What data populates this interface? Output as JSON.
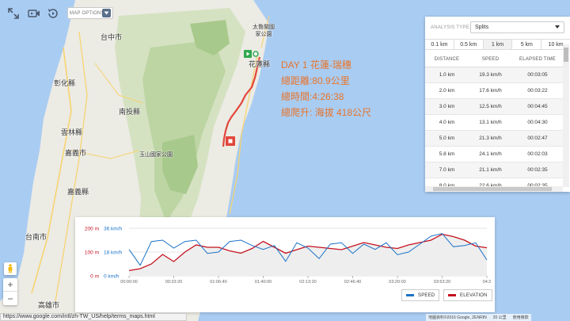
{
  "map": {
    "options_label": "MAP OPTIONS",
    "cities": [
      {
        "name": "台中市"
      },
      {
        "name": "彰化縣"
      },
      {
        "name": "南投縣"
      },
      {
        "name": "雲林縣"
      },
      {
        "name": "嘉義市"
      },
      {
        "name": "嘉義縣"
      },
      {
        "name": "台南市"
      },
      {
        "name": "高雄市"
      },
      {
        "name": "花蓮縣"
      },
      {
        "name": "太魯閣國家公園"
      },
      {
        "name": "玉山國家公園"
      }
    ],
    "route_color": "#e2463c",
    "start_marker_color": "#2fa84f",
    "end_marker_color": "#e2463c",
    "zoom_in": "+",
    "zoom_out": "−"
  },
  "day": {
    "title": "DAY 1 花蓮-瑞穗",
    "distance": "總距離:80.9公里",
    "time": "總時間:4:26:38",
    "climb": "總爬升: 海拔 418公尺",
    "color": "#e8742a"
  },
  "analysis": {
    "type_label": "ANALYSIS TYPE:",
    "type_value": "Splits",
    "tabs": [
      {
        "label": "0.1 km",
        "active": false
      },
      {
        "label": "0.5 km",
        "active": false
      },
      {
        "label": "1 km",
        "active": true
      },
      {
        "label": "5 km",
        "active": false
      },
      {
        "label": "10 km",
        "active": false
      }
    ],
    "columns": [
      "DISTANCE",
      "SPEED",
      "ELAPSED TIME"
    ],
    "rows": [
      [
        "1.0 km",
        "19.3 km/h",
        "00:03:05"
      ],
      [
        "2.0 km",
        "17.6 km/h",
        "00:03:22"
      ],
      [
        "3.0 km",
        "12.5 km/h",
        "00:04:45"
      ],
      [
        "4.0 km",
        "13.1 km/h",
        "00:04:30"
      ],
      [
        "5.0 km",
        "21.3 km/h",
        "00:02:47"
      ],
      [
        "5.8 km",
        "24.1 km/h",
        "00:02:03"
      ],
      [
        "7.0 km",
        "21.1 km/h",
        "00:02:35"
      ],
      [
        "8.0 km",
        "22.6 km/h",
        "00:02:35"
      ],
      [
        "9.0 km",
        "22.3 km/h",
        "00:02:40"
      ]
    ]
  },
  "chart_data": {
    "type": "line",
    "y_left_ticks": [
      "200 m",
      "100 m",
      "0 m"
    ],
    "y_right_ticks": [
      "36 km/h",
      "18 km/h",
      "0 km/h"
    ],
    "x_ticks": [
      "00:00:00",
      "00:33:20",
      "01:06:40",
      "01:40:00",
      "02:13:20",
      "02:46:40",
      "03:20:00",
      "03:53:20",
      "04:2"
    ],
    "x_range_seconds": [
      0,
      16000
    ],
    "elevation_ylim": [
      0,
      200
    ],
    "speed_ylim": [
      0,
      36
    ],
    "x": [
      0,
      500,
      1000,
      1500,
      2000,
      2500,
      3000,
      3500,
      4000,
      4500,
      5000,
      5500,
      6000,
      6500,
      7000,
      7500,
      8000,
      8500,
      9000,
      9500,
      10000,
      10500,
      11000,
      11500,
      12000,
      12500,
      13000,
      13500,
      14000,
      14500,
      15000,
      15500,
      16000
    ],
    "series": [
      {
        "name": "SPEED",
        "color": "#1a73c8",
        "values": [
          20,
          8,
          26,
          27,
          21,
          26,
          27,
          17,
          18,
          26,
          27,
          23,
          20,
          23,
          11,
          25,
          21,
          13,
          24,
          25,
          17,
          24,
          20,
          25,
          16,
          18,
          24,
          30,
          32,
          22,
          23,
          25,
          12
        ]
      },
      {
        "name": "ELEVATION",
        "color": "#c4121f",
        "values": [
          22,
          30,
          50,
          90,
          60,
          100,
          130,
          120,
          120,
          105,
          95,
          115,
          145,
          120,
          95,
          110,
          125,
          120,
          115,
          110,
          125,
          140,
          130,
          120,
          115,
          130,
          140,
          150,
          175,
          165,
          150,
          125,
          118
        ]
      }
    ],
    "legend": [
      "SPEED",
      "ELEVATION"
    ]
  },
  "footer": {
    "url": "https://www.google.com/intl/zh-TW_US/help/terms_maps.html",
    "attribution": "地圖資料©2016 Google, ZENRIN",
    "scale": "20 公里",
    "terms": "使用條款"
  }
}
